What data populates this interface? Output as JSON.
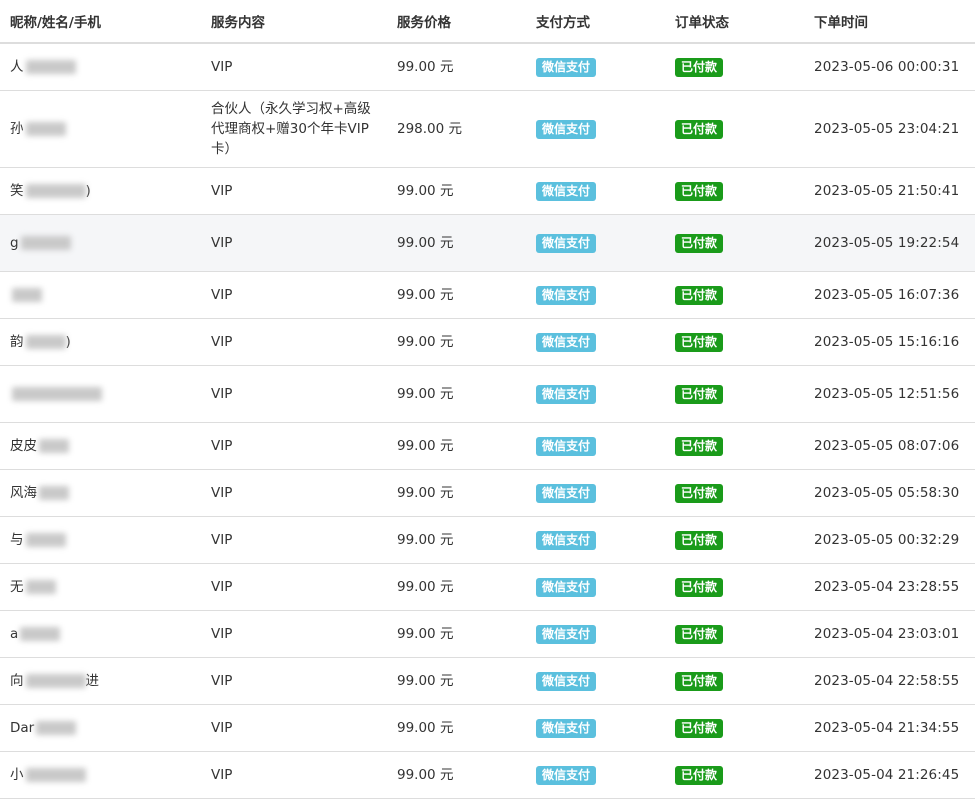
{
  "colors": {
    "wechat_badge": "#5bc0de",
    "paid_badge": "#1a9b1a"
  },
  "headers": [
    "昵称/姓名/手机",
    "服务内容",
    "服务价格",
    "支付方式",
    "订单状态",
    "下单时间"
  ],
  "rows": [
    {
      "name": "人",
      "service": "VIP",
      "price": "99.00 元",
      "payment": "微信支付",
      "status": "已付款",
      "time": "2023-05-06 00:00:31"
    },
    {
      "name": "孙",
      "service": "合伙人（永久学习权+高级代理商权+赠30个年卡VIP卡）",
      "price": "298.00 元",
      "payment": "微信支付",
      "status": "已付款",
      "time": "2023-05-05 23:04:21"
    },
    {
      "name": "笑",
      "name_tail": ")",
      "service": "VIP",
      "price": "99.00 元",
      "payment": "微信支付",
      "status": "已付款",
      "time": "2023-05-05 21:50:41"
    },
    {
      "name": "g",
      "service": "VIP",
      "price": "99.00 元",
      "payment": "微信支付",
      "status": "已付款",
      "time": "2023-05-05 19:22:54"
    },
    {
      "name": "",
      "service": "VIP",
      "price": "99.00 元",
      "payment": "微信支付",
      "status": "已付款",
      "time": "2023-05-05 16:07:36"
    },
    {
      "name": "韵",
      "name_tail": ")",
      "service": "VIP",
      "price": "99.00 元",
      "payment": "微信支付",
      "status": "已付款",
      "time": "2023-05-05 15:16:16"
    },
    {
      "name": "",
      "service": "VIP",
      "price": "99.00 元",
      "payment": "微信支付",
      "status": "已付款",
      "time": "2023-05-05 12:51:56"
    },
    {
      "name": "皮皮",
      "service": "VIP",
      "price": "99.00 元",
      "payment": "微信支付",
      "status": "已付款",
      "time": "2023-05-05 08:07:06"
    },
    {
      "name": "风海",
      "service": "VIP",
      "price": "99.00 元",
      "payment": "微信支付",
      "status": "已付款",
      "time": "2023-05-05 05:58:30"
    },
    {
      "name": "与",
      "service": "VIP",
      "price": "99.00 元",
      "payment": "微信支付",
      "status": "已付款",
      "time": "2023-05-05 00:32:29"
    },
    {
      "name": "无",
      "service": "VIP",
      "price": "99.00 元",
      "payment": "微信支付",
      "status": "已付款",
      "time": "2023-05-04 23:28:55"
    },
    {
      "name": "a",
      "service": "VIP",
      "price": "99.00 元",
      "payment": "微信支付",
      "status": "已付款",
      "time": "2023-05-04 23:03:01"
    },
    {
      "name": "向",
      "name_tail": "进",
      "service": "VIP",
      "price": "99.00 元",
      "payment": "微信支付",
      "status": "已付款",
      "time": "2023-05-04 22:58:55"
    },
    {
      "name": "Dar",
      "service": "VIP",
      "price": "99.00 元",
      "payment": "微信支付",
      "status": "已付款",
      "time": "2023-05-04 21:34:55"
    },
    {
      "name": "小",
      "service": "VIP",
      "price": "99.00 元",
      "payment": "微信支付",
      "status": "已付款",
      "time": "2023-05-04 21:26:45"
    }
  ]
}
